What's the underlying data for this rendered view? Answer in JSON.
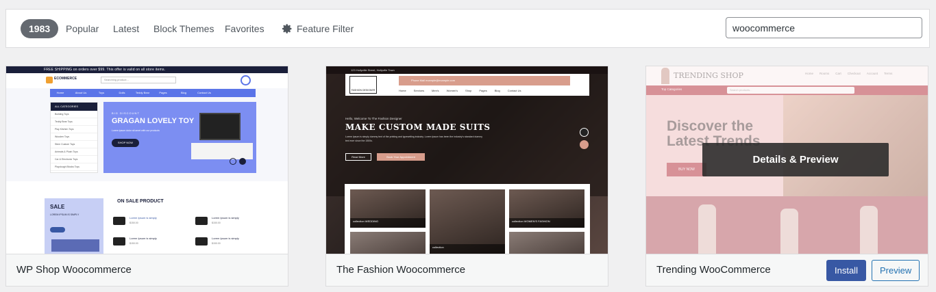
{
  "filter_bar": {
    "count": "1983",
    "tabs": [
      "Popular",
      "Latest",
      "Block Themes",
      "Favorites"
    ],
    "feature_filter": "Feature Filter",
    "search_value": "woocommerce"
  },
  "themes": [
    {
      "name": "WP Shop Woocommerce",
      "thumb": {
        "topbar": "FREE SHIPPING on orders over $99. This offer is valid on all store items.",
        "logo": "ECOMMERCE",
        "search": "Searching product...",
        "menu": [
          "Home",
          "About Us",
          "Toys",
          "Dolls",
          "Teddy Bear",
          "Pages",
          "Blog",
          "Contact Us"
        ],
        "sidebar_title": "ALL CATEGORIES",
        "sidebar_items": [
          "Building Toys",
          "Teddy Bear Toys",
          "Play Kitchen Toys",
          "Wooden Toys",
          "Stem Custom Toys",
          "Animals & Plush Toys",
          "Car & Electronic Toys",
          "Playdough Blocks Toys"
        ],
        "banner_small": "BIG DISCOUNT",
        "banner_title": "GRAGAN LOVELY TOY",
        "banner_sub": "Lorem ipsum dolor sit amet with our products",
        "banner_btn": "SHOP NOW",
        "sale_title": "SALE",
        "sale_sub": "LOREM IPSUM IS SIMPLY",
        "onsale_title": "ON SALE PRODUCT",
        "item_name": "Lorem Ipsum is simply",
        "item_price": "$150.00"
      }
    },
    {
      "name": "The Fashion Woocommerce",
      "thumb": {
        "topline": "123 Hollyville Street, Hollyville Town",
        "logo": "FASHION DESIGNER",
        "contact": "Phone   Mail   example@example.com",
        "menu": [
          "Home",
          "Services",
          "Men's",
          "Women's",
          "Shop",
          "Pages",
          "Blog",
          "Contact Us"
        ],
        "small": "Hello, Welcome To The Fashion Designer",
        "title": "MAKE CUSTOM MADE SUITS",
        "text": "Lorem Ipsum is simply dummy text of the printing and typesetting industry. Lorem Ipsum has been the industry's standard dummy text ever since the 1500s.",
        "btn1": "Read More",
        "btn2": "Book Your Appointment",
        "tile1": "collection WEDDING",
        "tile2": "collection",
        "tile3": "collection WOMEN'S FASHION"
      }
    },
    {
      "name": "Trending WooCommerce",
      "thumb": {
        "logo": "TRENDING SHOP",
        "nav": [
          "Home",
          "Rooms",
          "Cart",
          "Checkout",
          "Account",
          "Terms"
        ],
        "categories": "Top Categories",
        "search": "Search products...",
        "hero_title_1": "Discover the",
        "hero_title_2": "Latest Trends",
        "buy": "BUY NOW"
      },
      "overlay": "Details & Preview",
      "install": "Install",
      "preview": "Preview"
    }
  ]
}
